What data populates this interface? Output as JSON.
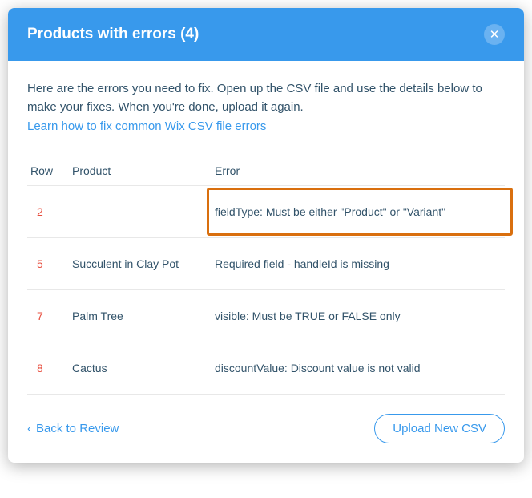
{
  "header": {
    "title": "Products with errors (4)",
    "close_icon": "✕"
  },
  "body": {
    "intro": "Here are the errors you need to fix. Open up the CSV file and use the details below to make your fixes. When you're done, upload it again.",
    "learn_link": "Learn how to fix common Wix CSV file errors"
  },
  "table": {
    "headers": {
      "row": "Row",
      "product": "Product",
      "error": "Error"
    },
    "rows": [
      {
        "row": "2",
        "product": "",
        "error": "fieldType: Must be either \"Product\" or \"Variant\"",
        "highlighted": true
      },
      {
        "row": "5",
        "product": "Succulent in Clay Pot",
        "error": "Required field - handleId is missing"
      },
      {
        "row": "7",
        "product": "Palm Tree",
        "error": "visible: Must be TRUE or FALSE only"
      },
      {
        "row": "8",
        "product": "Cactus",
        "error": "discountValue: Discount value is not valid"
      }
    ]
  },
  "footer": {
    "back_chevron": "‹",
    "back_label": "Back to Review",
    "upload_label": "Upload New CSV"
  }
}
